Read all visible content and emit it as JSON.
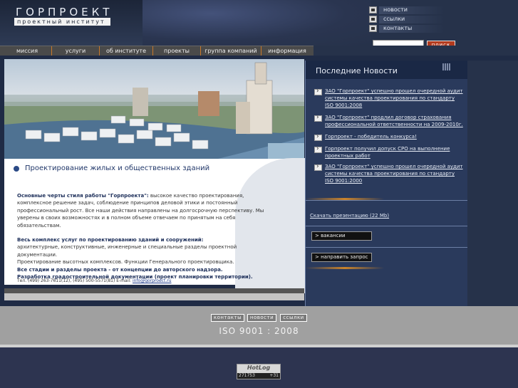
{
  "header": {
    "logo_title": "ГОРПРОЕКТ",
    "logo_subtitle": "проектный институт",
    "top_links": [
      {
        "label": "новости",
        "icon": "home-icon"
      },
      {
        "label": "ссылки",
        "icon": "link-icon"
      },
      {
        "label": "контакты",
        "icon": "mail-icon"
      }
    ],
    "search": {
      "value": "",
      "button_label": "поиск"
    }
  },
  "nav": {
    "items": [
      "миссия",
      "услуги",
      "об институте",
      "проекты",
      "группа компаний",
      "информация"
    ]
  },
  "hero": {
    "title": "Проектирование жилых и общественных зданий"
  },
  "content": {
    "intro_bold": "Основные черты стиля работы \"Горпроекта\":",
    "intro_text": " высокое качество проектирования, комплексное решение задач, соблюдение принципов деловой этики и постоянный профессиональный рост. Все наши действия направлены на долгосрочную перспективу.  Мы уверены в своих возможностях и в полном объеме отвечаем по принятым на себя обязательствам.",
    "services_bold": "Весь комплекс услуг по проектированию зданий и сооружений:",
    "services_line1": "архитектурные, конструктивные, инженерные  и специальные разделы проектной документации.",
    "services_line2": "Проектирование высотных комплексов.  Функции Генерального проектировщика.",
    "stages_bold1": "Все стадии и разделы проекта -  от концепции до авторского надзора.",
    "stages_bold2": "Разработка градостроительной документации (проект планировки территории).",
    "phones": "Тел. (499) 263-7611(12),   (495) 500-5571(81)       E-mail: ",
    "email": "info@gorproect.ru"
  },
  "news": {
    "title": "Последние Новости",
    "items": [
      "ЗАО \"Горпроект\" успешно прошел очередной аудит системы качества проектирования по стандарту ISO 9001:2008",
      "ЗАО \"Горпроект\" продлил договор страхования профессиональной ответственности на 2009-2010г.",
      "Горпроект - победитель конкурса!",
      "Горпроект получил допуск СРО на выполнение проектных работ",
      "ЗАО \"Горпроект\" успешно прошел очередной аудит системы качества проектирования по стандарту ISO 9001:2000"
    ],
    "download": "Скачать презентацию (22 Mb)",
    "vacancies": "> вакансии",
    "request": "> направить запрос"
  },
  "footer": {
    "links": [
      "контакты",
      "новости",
      "ссылки"
    ],
    "iso": "ISO 9001 : 2008",
    "counter_logo": "HotLog",
    "counter_left": "271753",
    "counter_right": "+31"
  }
}
